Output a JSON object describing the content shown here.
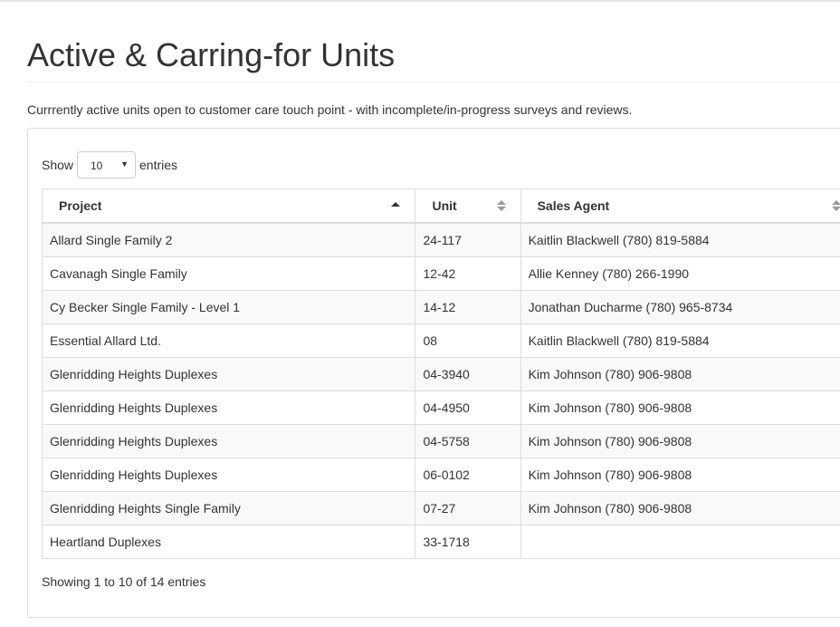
{
  "page": {
    "title": "Active & Carring-for Units",
    "subtitle": "Currrently active units open to customer care touch point - with incomplete/in-progress surveys and reviews."
  },
  "length_control": {
    "show_label": "Show",
    "selected": "10",
    "entries_label": "entries"
  },
  "table": {
    "columns": [
      {
        "label": "Project",
        "sort": "ascending"
      },
      {
        "label": "Unit",
        "sort": "none"
      },
      {
        "label": "Sales Agent",
        "sort": "none"
      }
    ],
    "rows": [
      {
        "project": "Allard Single Family 2",
        "unit": "24-117",
        "agent": "Kaitlin Blackwell (780) 819-5884"
      },
      {
        "project": "Cavanagh Single Family",
        "unit": "12-42",
        "agent": "Allie Kenney (780) 266-1990"
      },
      {
        "project": "Cy Becker Single Family - Level 1",
        "unit": "14-12",
        "agent": "Jonathan Ducharme (780) 965-8734"
      },
      {
        "project": "Essential Allard Ltd.",
        "unit": "08",
        "agent": "Kaitlin Blackwell (780) 819-5884"
      },
      {
        "project": "Glenridding Heights Duplexes",
        "unit": "04-3940",
        "agent": "Kim Johnson (780) 906-9808"
      },
      {
        "project": "Glenridding Heights Duplexes",
        "unit": "04-4950",
        "agent": "Kim Johnson (780) 906-9808"
      },
      {
        "project": "Glenridding Heights Duplexes",
        "unit": "04-5758",
        "agent": "Kim Johnson (780) 906-9808"
      },
      {
        "project": "Glenridding Heights Duplexes",
        "unit": "06-0102",
        "agent": "Kim Johnson (780) 906-9808"
      },
      {
        "project": "Glenridding Heights Single Family",
        "unit": "07-27",
        "agent": "Kim Johnson (780) 906-9808"
      },
      {
        "project": "Heartland Duplexes",
        "unit": "33-1718",
        "agent": ""
      }
    ]
  },
  "info": "Showing 1 to 10 of 14 entries",
  "icons": {
    "sort_ascending": "sort-ascending-icon",
    "sort_both": "sort-both-icon",
    "select_caret": "chevron-down-icon"
  },
  "colors": {
    "text": "#333333",
    "border": "#dddddd",
    "stripe": "#f9f9f9",
    "sort_active": "#333333",
    "sort_inactive": "#999999"
  }
}
